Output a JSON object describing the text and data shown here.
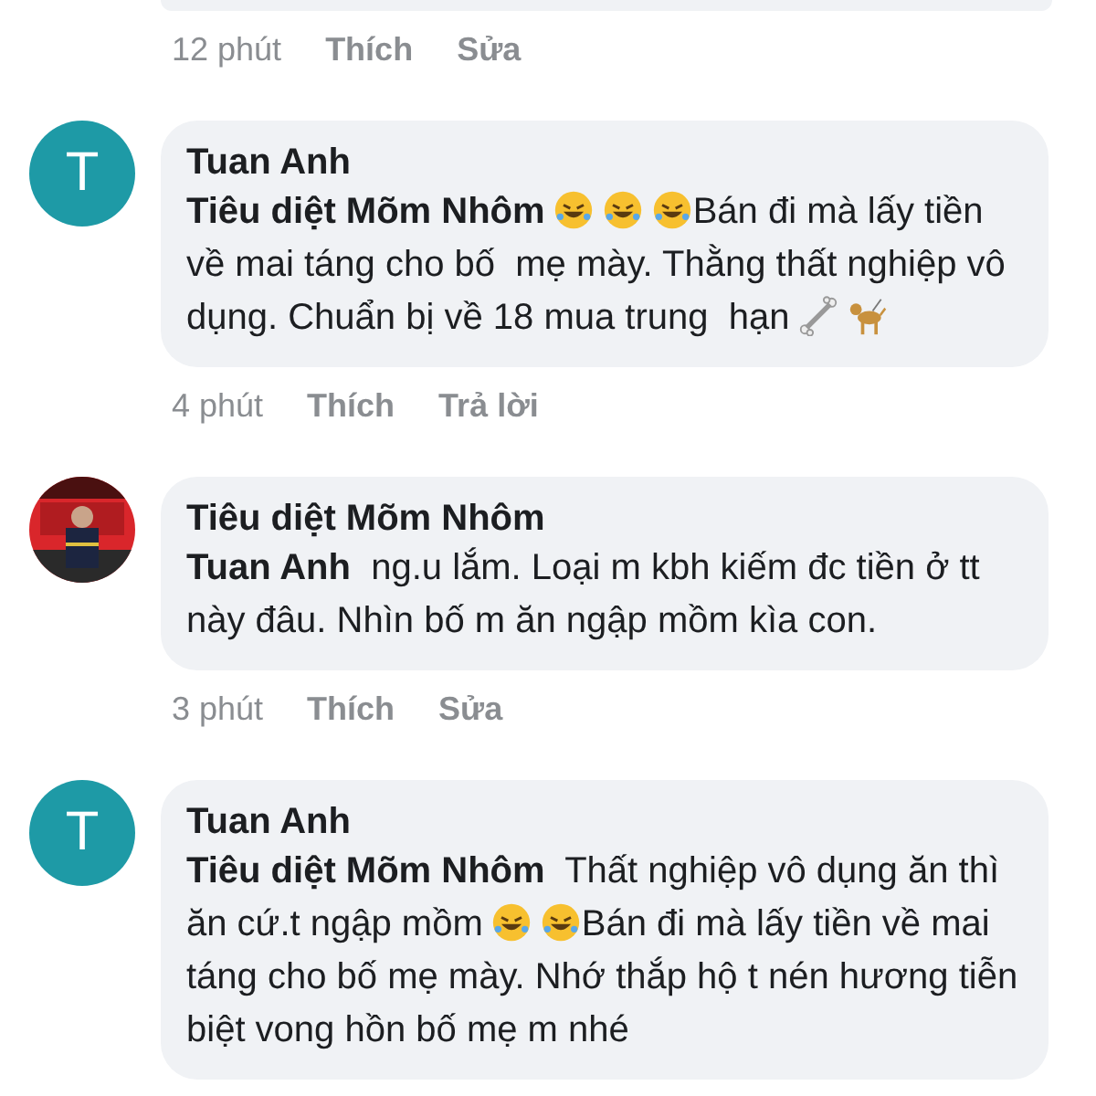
{
  "previous_comment": {
    "time": "12 phút",
    "actions": [
      "Thích",
      "Sửa"
    ]
  },
  "comments": [
    {
      "avatar": {
        "kind": "letter",
        "letter": "T"
      },
      "author": "Tuan Anh",
      "mention": "Tiêu diệt Mõm Nhôm",
      "body": [
        {
          "kind": "laugh"
        },
        {
          "kind": "laugh"
        },
        {
          "kind": "laugh"
        },
        {
          "kind": "text",
          "text": "Bán đi mà lấy tiền về mai táng cho bố  mẹ mày. Thằng thất nghiệp vô dụng. Chuẩn bị về 18 mua trung  hạn"
        },
        {
          "kind": "bone"
        },
        {
          "kind": "dog"
        }
      ],
      "time": "4 phút",
      "actions": [
        "Thích",
        "Trả lời"
      ]
    },
    {
      "avatar": {
        "kind": "picture"
      },
      "author": "Tiêu diệt Mõm Nhôm",
      "mention": "Tuan Anh",
      "body": [
        {
          "kind": "text",
          "text": "  ng.u lắm. Loại m kbh kiếm đc tiền ở tt này đâu. Nhìn bố m ăn ngập mồm kìa con."
        }
      ],
      "time": "3 phút",
      "actions": [
        "Thích",
        "Sửa"
      ]
    },
    {
      "avatar": {
        "kind": "letter",
        "letter": "T"
      },
      "author": "Tuan Anh",
      "mention": "Tiêu diệt Mõm Nhôm",
      "body": [
        {
          "kind": "text",
          "text": "  Thất nghiệp vô dụng ăn thì ăn cứ.t ngập mồm"
        },
        {
          "kind": "laugh"
        },
        {
          "kind": "laugh"
        },
        {
          "kind": "text",
          "text": "Bán đi mà lấy tiền về mai táng cho bố mẹ mày. Nhớ thắp hộ t nén hương tiễn biệt vong hồn bố mẹ m nhé"
        }
      ]
    }
  ]
}
